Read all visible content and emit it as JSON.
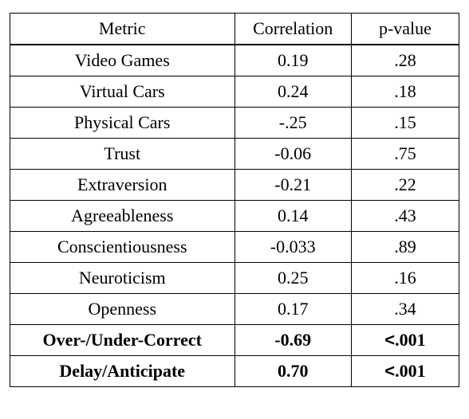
{
  "headers": {
    "metric": "Metric",
    "correlation": "Correlation",
    "pvalue": "p-value"
  },
  "rows": [
    {
      "metric": "Video Games",
      "correlation": "0.19",
      "pvalue": ".28",
      "bold": false,
      "lt": false
    },
    {
      "metric": "Virtual Cars",
      "correlation": "0.24",
      "pvalue": ".18",
      "bold": false,
      "lt": false
    },
    {
      "metric": "Physical Cars",
      "correlation": "-.25",
      "pvalue": ".15",
      "bold": false,
      "lt": false
    },
    {
      "metric": "Trust",
      "correlation": "-0.06",
      "pvalue": ".75",
      "bold": false,
      "lt": false
    },
    {
      "metric": "Extraversion",
      "correlation": "-0.21",
      "pvalue": ".22",
      "bold": false,
      "lt": false
    },
    {
      "metric": "Agreeableness",
      "correlation": "0.14",
      "pvalue": ".43",
      "bold": false,
      "lt": false
    },
    {
      "metric": "Conscientiousness",
      "correlation": "-0.033",
      "pvalue": ".89",
      "bold": false,
      "lt": false
    },
    {
      "metric": "Neuroticism",
      "correlation": "0.25",
      "pvalue": ".16",
      "bold": false,
      "lt": false
    },
    {
      "metric": "Openness",
      "correlation": "0.17",
      "pvalue": ".34",
      "bold": false,
      "lt": false
    },
    {
      "metric": "Over-/Under-Correct",
      "correlation": "-0.69",
      "pvalue": ".001",
      "bold": true,
      "lt": true
    },
    {
      "metric": "Delay/Anticipate",
      "correlation": "0.70",
      "pvalue": ".001",
      "bold": true,
      "lt": true
    }
  ]
}
